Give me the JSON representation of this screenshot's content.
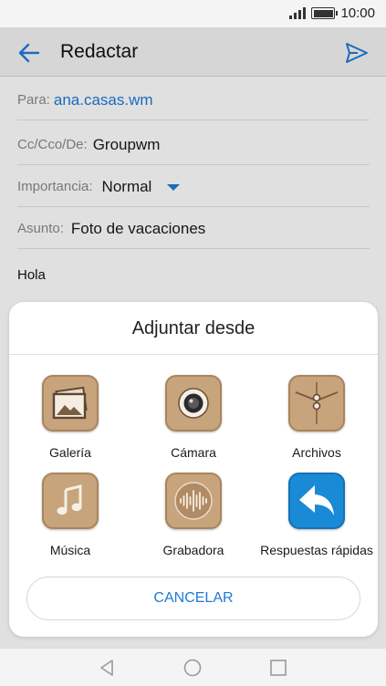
{
  "status_bar": {
    "time": "10:00"
  },
  "app_bar": {
    "title": "Redactar"
  },
  "compose": {
    "to_label": "Para:",
    "to_value": "ana.casas.wm",
    "cc_label": "Cc/Cco/De:",
    "cc_value": "Groupwm",
    "importance_label": "Importancia:",
    "importance_value": "Normal",
    "subject_label": "Asunto:",
    "subject_value": "Foto de vacaciones",
    "body": "Hola"
  },
  "attach_sheet": {
    "title": "Adjuntar desde",
    "items": [
      {
        "label": "Galería",
        "icon": "gallery-icon"
      },
      {
        "label": "Cámara",
        "icon": "camera-icon"
      },
      {
        "label": "Archivos",
        "icon": "files-icon"
      },
      {
        "label": "Música",
        "icon": "music-icon"
      },
      {
        "label": "Grabadora",
        "icon": "recorder-icon"
      },
      {
        "label": "Respuestas rápidas",
        "icon": "quick-reply-icon"
      }
    ],
    "cancel_label": "CANCELAR"
  },
  "colors": {
    "accent": "#1e7ad6",
    "tile": "#c7a47c",
    "quick_reply_tile": "#1a8ad6"
  }
}
